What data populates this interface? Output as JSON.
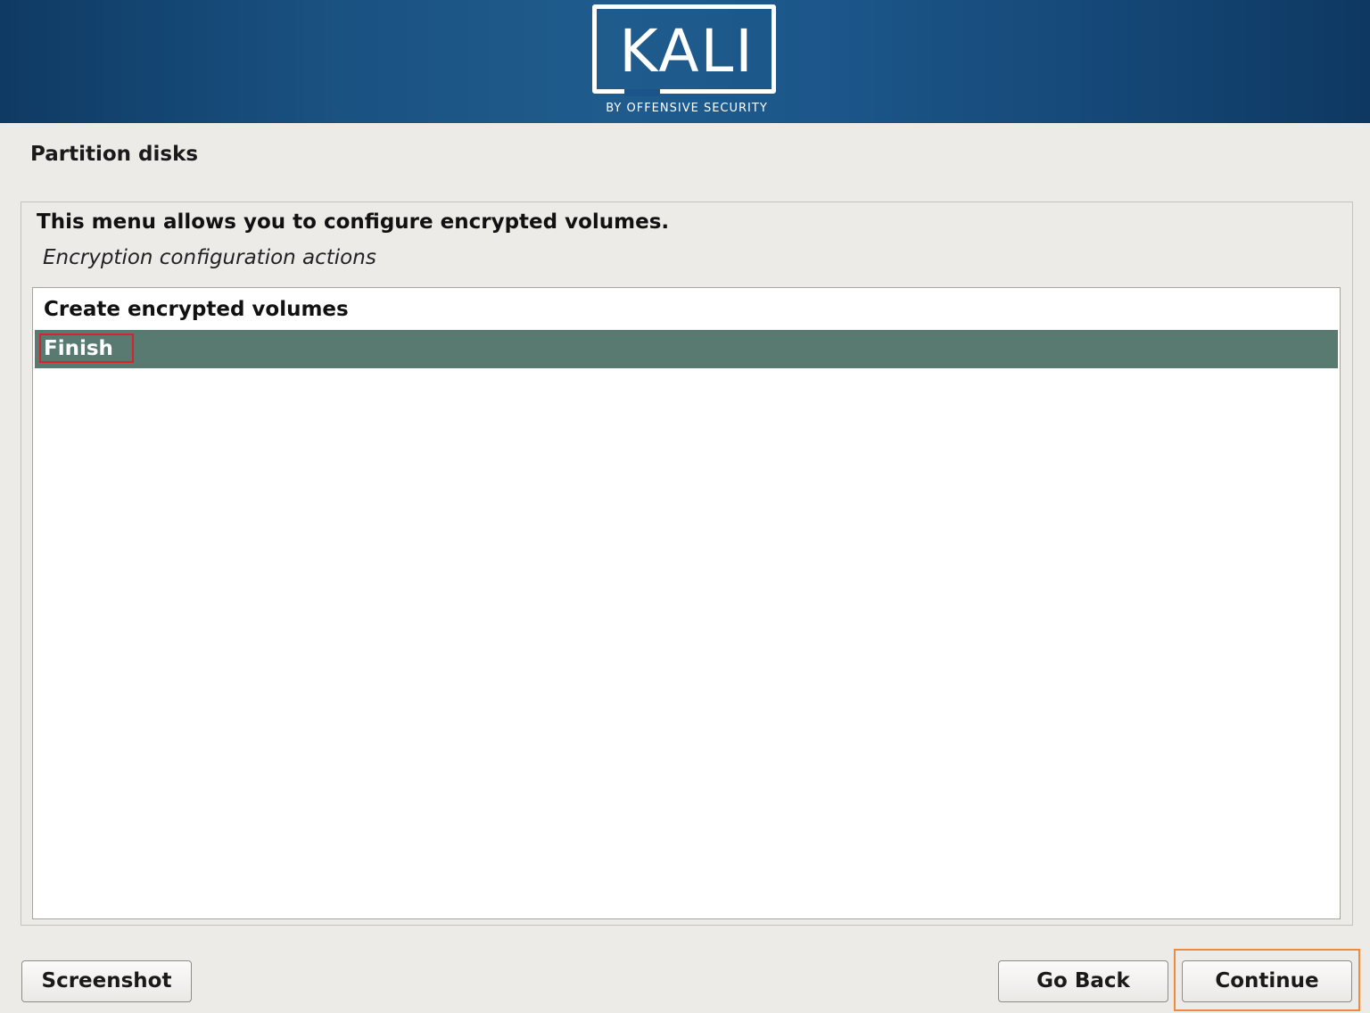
{
  "banner": {
    "logo_text": "KALI",
    "logo_subtitle": "BY OFFENSIVE SECURITY"
  },
  "page": {
    "title": "Partition disks"
  },
  "panel": {
    "description": "This menu allows you to configure encrypted volumes.",
    "subtitle": "Encryption configuration actions",
    "items": [
      {
        "label": "Create encrypted volumes",
        "selected": false
      },
      {
        "label": "Finish",
        "selected": true
      }
    ]
  },
  "buttons": {
    "screenshot": "Screenshot",
    "go_back": "Go Back",
    "continue": "Continue"
  },
  "colors": {
    "banner": "#1b5488",
    "selection": "#587a71",
    "highlight_red": "#d8222e",
    "highlight_orange": "#f08a3c"
  }
}
